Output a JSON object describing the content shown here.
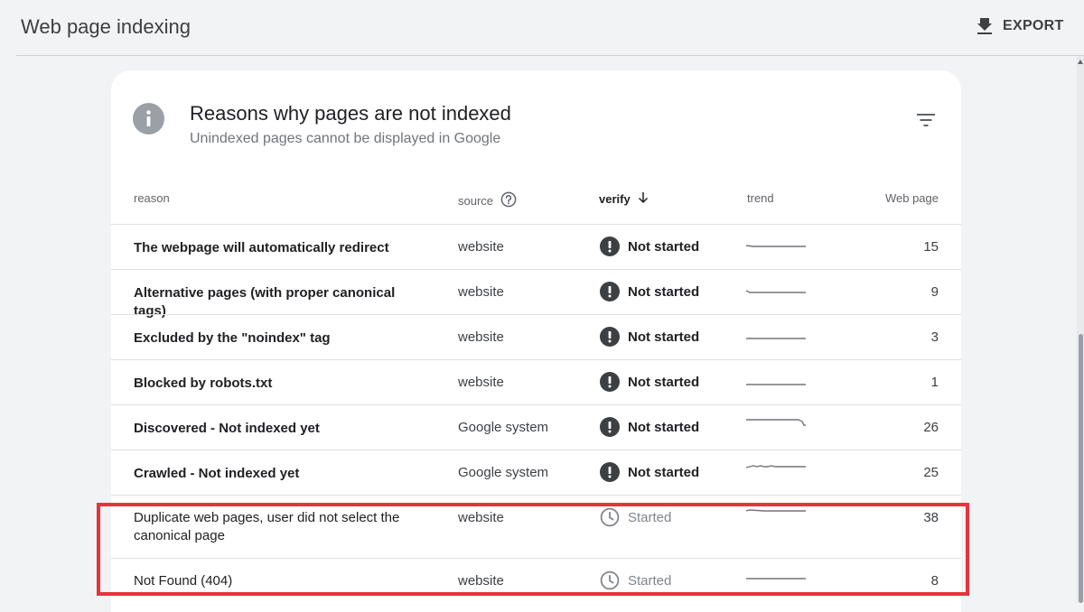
{
  "header": {
    "title": "Web page indexing",
    "export_label": "EXPORT"
  },
  "card": {
    "title": "Reasons why pages are not indexed",
    "subtitle": "Unindexed pages cannot be displayed in Google"
  },
  "columns": {
    "reason": "reason",
    "source": "source",
    "verify": "verify",
    "trend": "trend",
    "pages": "Web page"
  },
  "rows": [
    {
      "reason": "The webpage will automatically redirect",
      "source": "website",
      "status": "Not started",
      "count": "15"
    },
    {
      "reason": "Alternative pages (with proper canonical tags)",
      "source": "website",
      "status": "Not started",
      "count": "9"
    },
    {
      "reason": "Excluded by the \"noindex\" tag",
      "source": "website",
      "status": "Not started",
      "count": "3"
    },
    {
      "reason": "Blocked by robots.txt",
      "source": "website",
      "status": "Not started",
      "count": "1"
    },
    {
      "reason": "Discovered - Not indexed yet",
      "source": "Google system",
      "status": "Not started",
      "count": "26"
    },
    {
      "reason": "Crawled - Not indexed yet",
      "source": "Google system",
      "status": "Not started",
      "count": "25"
    },
    {
      "reason": "Duplicate web pages, user did not select the canonical page",
      "source": "website",
      "status": "Started",
      "count": "38"
    },
    {
      "reason": "Not Found (404)",
      "source": "website",
      "status": "Started",
      "count": "8"
    }
  ],
  "icons": {
    "export": "download-icon",
    "info": "info-icon",
    "filter": "filter-icon",
    "help": "help-circle-icon",
    "sort": "arrow-down-icon",
    "not_started": "exclamation-circle-icon",
    "started": "clock-icon"
  },
  "colors": {
    "highlight": "#e8323c",
    "status_not_started": "#3c4043",
    "status_started": "#80868b"
  }
}
